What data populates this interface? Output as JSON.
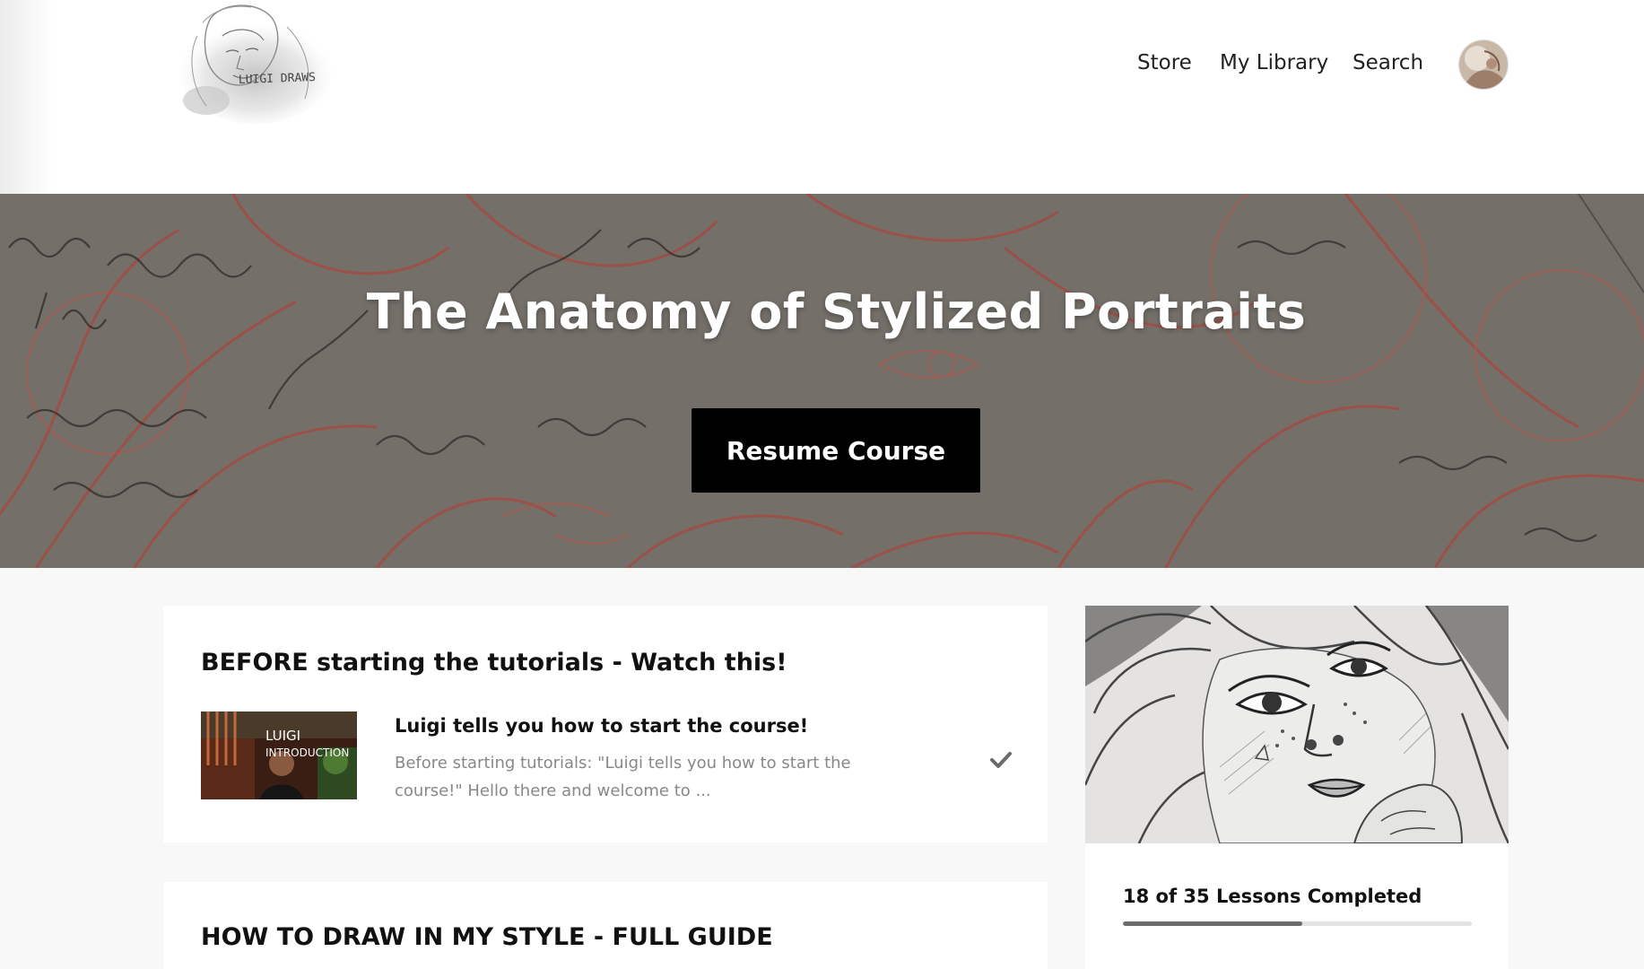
{
  "brand": {
    "logo_text": "LUIGI DRAWS"
  },
  "nav": {
    "store": "Store",
    "library": "My Library",
    "search": "Search"
  },
  "hero": {
    "title": "The Anatomy of Stylized Portraits",
    "resume_label": "Resume Course"
  },
  "sections": [
    {
      "title": "BEFORE starting the tutorials - Watch this!",
      "lessons": [
        {
          "thumb_text_1": "LUIGI",
          "thumb_text_2": "INTRODUCTION",
          "title": "Luigi tells you how to start the course!",
          "description": "Before starting tutorials: \"Luigi tells you how to start the course!\" Hello there and welcome to ...",
          "completed": true
        }
      ]
    },
    {
      "title": "HOW TO DRAW IN MY STYLE - FULL GUIDE"
    }
  ],
  "progress": {
    "label": "18 of 35 Lessons Completed",
    "completed": 18,
    "total": 35
  },
  "colors": {
    "button_bg": "#000000",
    "progress_fill": "#6b6b6b",
    "progress_track": "#e2e2e2"
  }
}
